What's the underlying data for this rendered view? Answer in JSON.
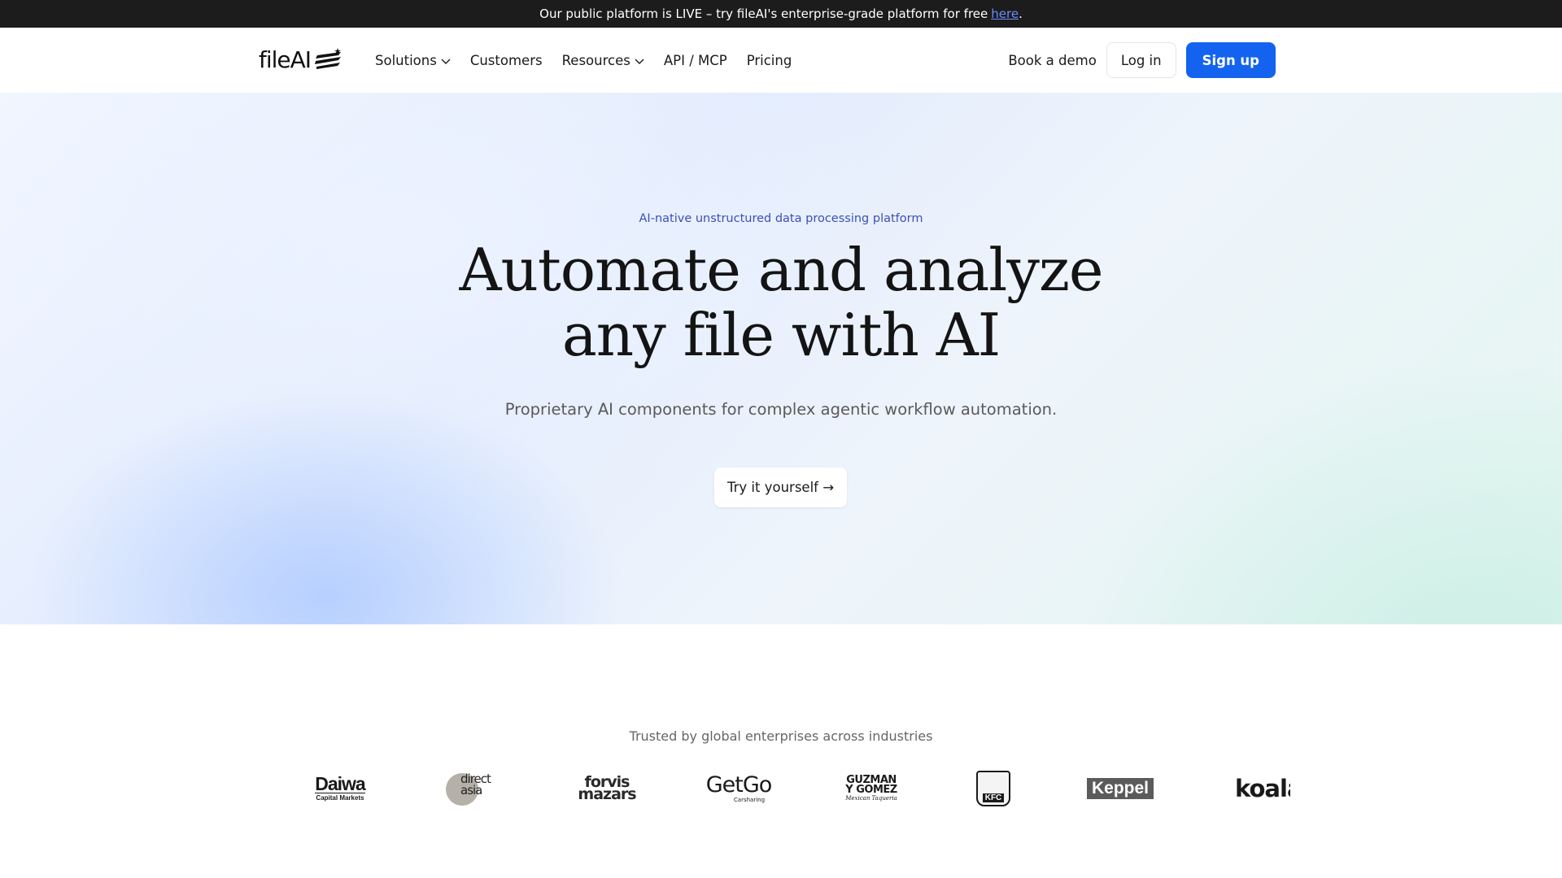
{
  "announcement": {
    "text": "Our public platform is LIVE – try fileAI's enterprise-grade platform for free",
    "link": "here",
    "suffix": "."
  },
  "nav": {
    "logo": "fileAI",
    "links": [
      "Solutions",
      "Customers",
      "Resources",
      "API / MCP",
      "Pricing"
    ],
    "book_demo": "Book a demo",
    "login": "Log in",
    "signup": "Sign up"
  },
  "hero": {
    "eyebrow": "AI-native unstructured data processing platform",
    "headline_line1": "Automate and analyze",
    "headline_line2": "any file with AI",
    "subheadline": "Proprietary AI components for complex agentic workflow automation.",
    "cta": "Try it yourself →"
  },
  "trusted": {
    "title": "Trusted by global enterprises across industries",
    "logos": [
      {
        "name": "Daiwa",
        "sub": "Capital Markets"
      },
      {
        "name": "direct asia"
      },
      {
        "name": "forvis mazars"
      },
      {
        "name": "GetGo",
        "sub": "Carsharing"
      },
      {
        "name": "GUZMAN Y GOMEZ",
        "sub": "Mexican Taqueria"
      },
      {
        "name": "KFC"
      },
      {
        "name": "Keppel"
      },
      {
        "name": "koala"
      }
    ]
  },
  "colors": {
    "brand_blue": "#1463f0",
    "announce_bg": "#1c1c1c",
    "eyebrow": "#3b4fb8"
  }
}
